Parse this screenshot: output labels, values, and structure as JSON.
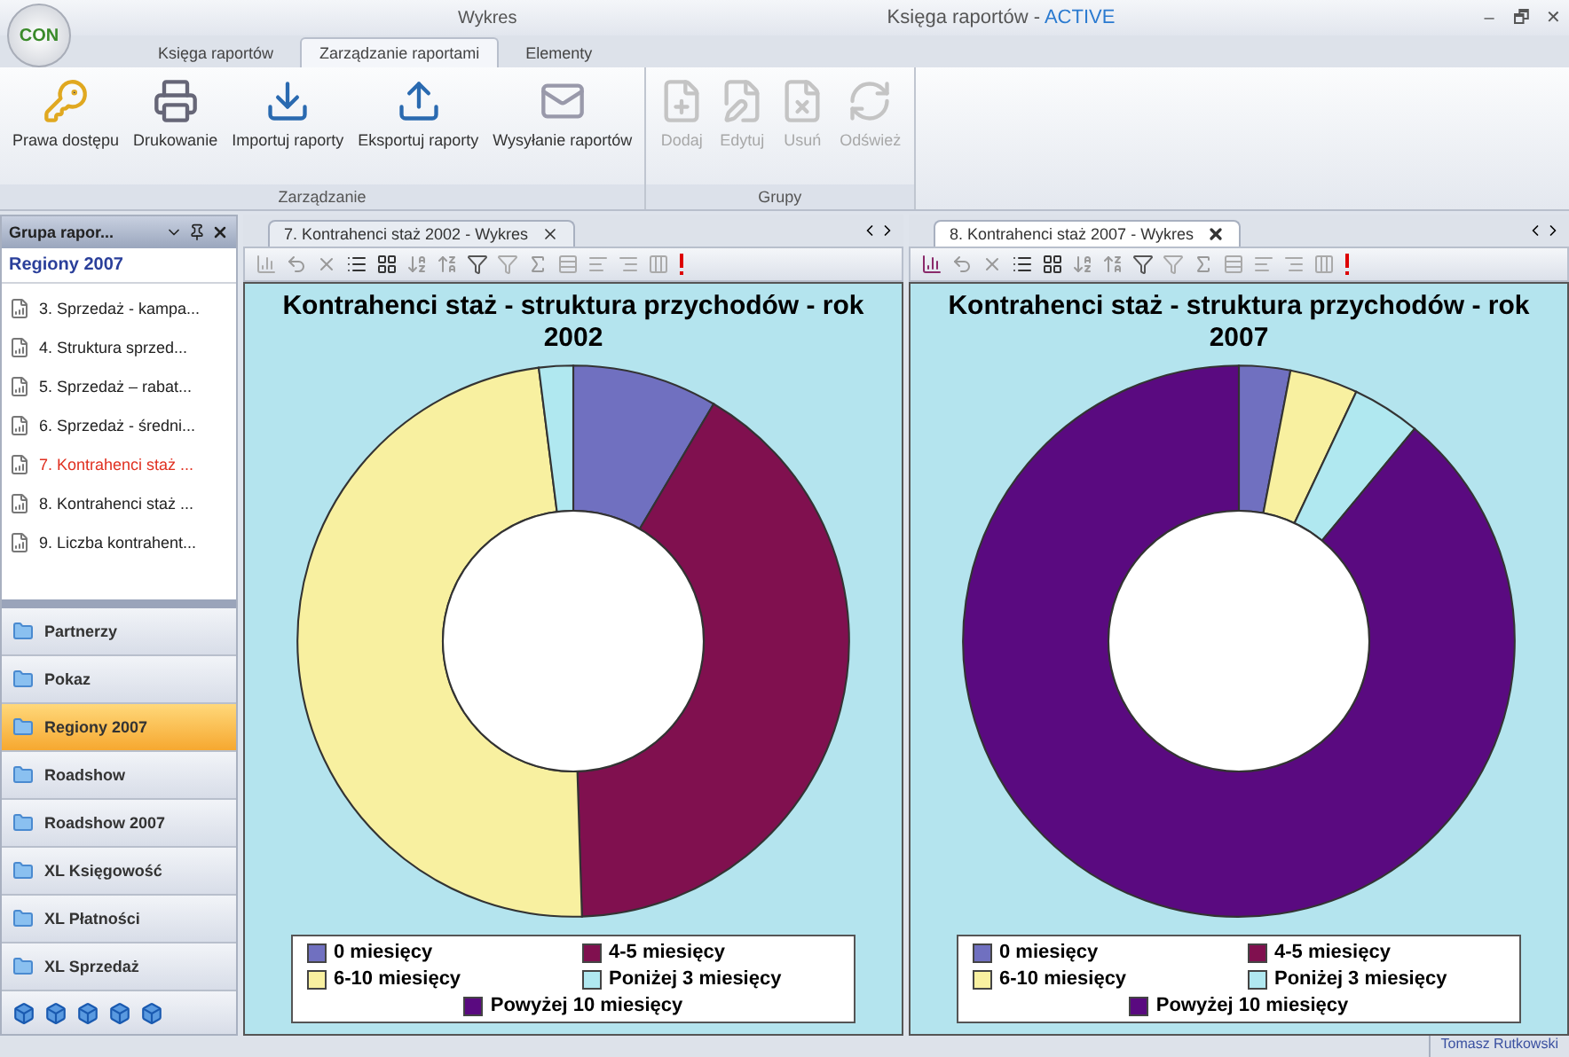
{
  "window": {
    "app_button": "CON",
    "context_tab": "Wykres",
    "title": "Księga raportów - ",
    "title_accent": "ACTIVE",
    "controls": [
      "–",
      "🗗",
      "✕"
    ]
  },
  "ribbon_tabs": [
    {
      "label": "Księga raportów",
      "selected": false
    },
    {
      "label": "Zarządzanie raportami",
      "selected": true
    },
    {
      "label": "Elementy",
      "selected": false
    }
  ],
  "ribbon_groups": [
    {
      "label": "Zarządzanie",
      "buttons": [
        {
          "label": "Prawa dostępu",
          "kind": "key",
          "disabled": false
        },
        {
          "label": "Drukowanie",
          "kind": "printer",
          "disabled": false
        },
        {
          "label": "Importuj raporty",
          "kind": "import",
          "disabled": false
        },
        {
          "label": "Eksportuj raporty",
          "kind": "export",
          "disabled": false
        },
        {
          "label": "Wysyłanie raportów",
          "kind": "mail",
          "disabled": false
        }
      ]
    },
    {
      "label": "Grupy",
      "buttons": [
        {
          "label": "Dodaj",
          "kind": "add",
          "disabled": true
        },
        {
          "label": "Edytuj",
          "kind": "edit",
          "disabled": true
        },
        {
          "label": "Usuń",
          "kind": "delete",
          "disabled": true
        },
        {
          "label": "Odśwież",
          "kind": "refresh",
          "disabled": true
        }
      ]
    }
  ],
  "side_panel": {
    "title": "Grupa rapor...",
    "group_heading": "Regiony 2007",
    "reports": [
      {
        "label": "3. Sprzedaż - kampa...",
        "selected": false
      },
      {
        "label": "4. Struktura sprzed...",
        "selected": false
      },
      {
        "label": "5. Sprzedaż – rabat...",
        "selected": false
      },
      {
        "label": "6. Sprzedaż - średni...",
        "selected": false
      },
      {
        "label": "7. Kontrahenci staż ...",
        "selected": true
      },
      {
        "label": "8. Kontrahenci staż ...",
        "selected": false
      },
      {
        "label": "9. Liczba kontrahent...",
        "selected": false
      }
    ],
    "groups": [
      {
        "label": "Partnerzy",
        "selected": false
      },
      {
        "label": "Pokaz",
        "selected": false
      },
      {
        "label": "Regiony 2007",
        "selected": true
      },
      {
        "label": "Roadshow",
        "selected": false
      },
      {
        "label": "Roadshow 2007",
        "selected": false
      },
      {
        "label": "XL Księgowość",
        "selected": false
      },
      {
        "label": "XL Płatności",
        "selected": false
      },
      {
        "label": "XL Sprzedaż",
        "selected": false
      }
    ]
  },
  "documents": [
    {
      "tab": "7. Kontrahenci staż 2002 - Wykres",
      "active": false,
      "chart_title": "Kontrahenci staż - struktura przychodów - rok 2002",
      "legend": [
        {
          "label": "0 miesięcy",
          "color": "#7070c0"
        },
        {
          "label": "4-5 miesięcy",
          "color": "#80104f"
        },
        {
          "label": "6-10 miesięcy",
          "color": "#f8f0a0"
        },
        {
          "label": "Poniżej 3 miesięcy",
          "color": "#b0e8f0"
        },
        {
          "label": "Powyżej 10 miesięcy",
          "color": "#5a0a80"
        }
      ]
    },
    {
      "tab": "8. Kontrahenci staż 2007 - Wykres",
      "active": true,
      "chart_title": "Kontrahenci staż - struktura przychodów - rok 2007",
      "legend": [
        {
          "label": "0 miesięcy",
          "color": "#7070c0"
        },
        {
          "label": "4-5 miesięcy",
          "color": "#80104f"
        },
        {
          "label": "6-10 miesięcy",
          "color": "#f8f0a0"
        },
        {
          "label": "Poniżej 3 miesięcy",
          "color": "#b0e8f0"
        },
        {
          "label": "Powyżej 10 miesięcy",
          "color": "#5a0a80"
        }
      ]
    }
  ],
  "status_bar": {
    "user": "Tomasz Rutkowski"
  }
}
